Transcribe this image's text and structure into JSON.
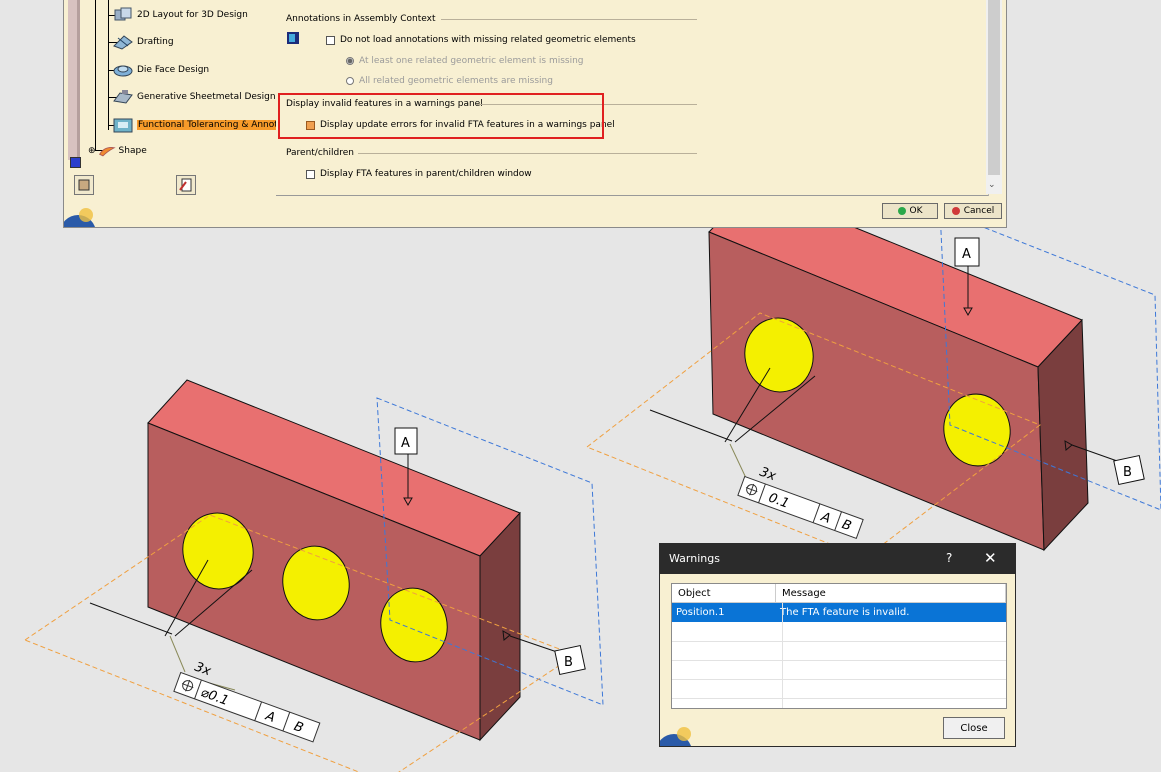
{
  "options_dialog": {
    "tree_items": [
      {
        "label": "2D Layout for 3D Design",
        "icon": "layout-3d-icon"
      },
      {
        "label": "Drafting",
        "icon": "drafting-icon"
      },
      {
        "label": "Die Face Design",
        "icon": "die-face-icon"
      },
      {
        "label": "Generative Sheetmetal Design",
        "icon": "sheetmetal-icon"
      },
      {
        "label": "Functional Tolerancing & Annota",
        "icon": "fta-icon",
        "selected": true
      },
      {
        "label": "Shape",
        "icon": "shape-icon"
      }
    ],
    "groups": {
      "assembly": {
        "title": "Annotations in Assembly Context",
        "checkbox_label": "Do not load annotations with missing related geometric elements",
        "radio_1": "At least one related geometric element is missing",
        "radio_2": "All related geometric elements are missing"
      },
      "warnings_panel": {
        "title": "Display invalid features in a warnings panel",
        "checkbox_label": "Display update errors for invalid FTA features in a warnings panel"
      },
      "parent_children": {
        "title": "Parent/children",
        "checkbox_label": "Display FTA features in parent/children window"
      }
    },
    "ok_label": "OK",
    "cancel_label": "Cancel",
    "colors": {
      "selection": "#f79b2a",
      "highlight_box": "#e02020"
    }
  },
  "scene": {
    "datum_labels": [
      "A",
      "B",
      "A",
      "B"
    ],
    "multiplier_labels": [
      "3x",
      "3x"
    ],
    "fcf_left": {
      "value": "⌀0.1",
      "ref1": "A",
      "ref2": "B"
    },
    "fcf_right": {
      "value": "0.1",
      "ref1": "A",
      "ref2": "B"
    },
    "colors": {
      "part_top": "#e87070",
      "part_front": "#b85e5e",
      "part_side": "#7a3e3e",
      "hole": "#f0f000",
      "plane_blue": "#3d78d8",
      "plane_orange": "#f0a040"
    }
  },
  "warnings_dialog": {
    "title": "Warnings",
    "help_glyph": "?",
    "close_glyph": "✕",
    "columns": [
      "Object",
      "Message"
    ],
    "rows": [
      {
        "object": "Position.1",
        "message": "The FTA feature is invalid."
      }
    ],
    "close_label": "Close"
  }
}
